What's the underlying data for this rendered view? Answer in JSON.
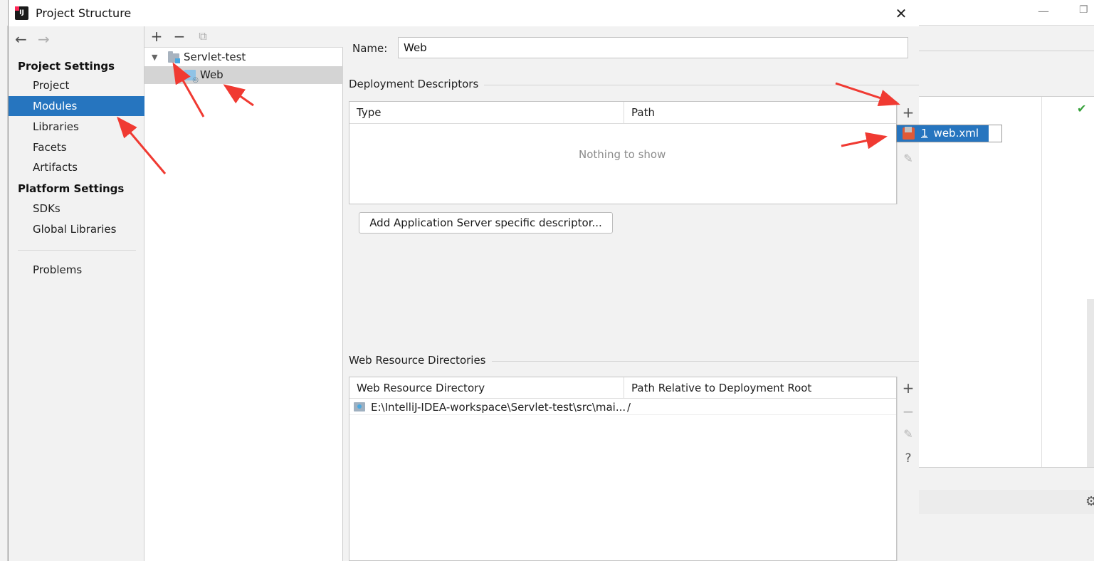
{
  "dialog": {
    "title": "Project Structure",
    "close": "✕"
  },
  "sidebar": {
    "project_settings_header": "Project Settings",
    "project_settings_items": [
      {
        "label": "Project",
        "selected": false
      },
      {
        "label": "Modules",
        "selected": true
      },
      {
        "label": "Libraries",
        "selected": false
      },
      {
        "label": "Facets",
        "selected": false
      },
      {
        "label": "Artifacts",
        "selected": false
      }
    ],
    "platform_settings_header": "Platform Settings",
    "platform_settings_items": [
      {
        "label": "SDKs"
      },
      {
        "label": "Global Libraries"
      }
    ],
    "problems_label": "Problems"
  },
  "tree": {
    "toolbar": {
      "add": "+",
      "remove": "−",
      "copy": "⧉"
    },
    "root": {
      "label": "Servlet-test",
      "expanded": true
    },
    "child": {
      "label": "Web",
      "selected": true
    }
  },
  "facet": {
    "name_label": "Name:",
    "name_value": "Web",
    "deployment_descriptors": {
      "title": "Deployment Descriptors",
      "columns": [
        "Type",
        "Path"
      ],
      "empty_text": "Nothing to show",
      "add_button": "Add Application Server specific descriptor..."
    },
    "popup": {
      "index": "1",
      "label": "web.xml"
    },
    "web_resource_directories": {
      "title": "Web Resource Directories",
      "columns": [
        "Web Resource Directory",
        "Path Relative to Deployment Root"
      ],
      "rows": [
        {
          "directory": "E:\\IntelliJ-IDEA-workspace\\Servlet-test\\src\\mai...",
          "relative_path": "/"
        }
      ]
    }
  },
  "colors": {
    "selection": "#2675bf",
    "annotation_arrow": "#f03a32",
    "panel_bg": "#f2f2f2"
  }
}
